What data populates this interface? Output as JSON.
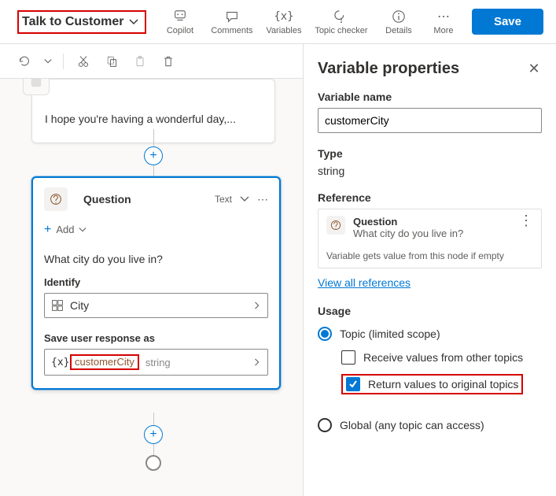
{
  "header": {
    "title": "Talk to Customer",
    "tools": {
      "copilot": "Copilot",
      "comments": "Comments",
      "variables": "Variables",
      "topicChecker": "Topic checker",
      "details": "Details",
      "more": "More"
    },
    "save": "Save"
  },
  "canvas": {
    "message": "I hope you're having a wonderful day,...",
    "question": {
      "title": "Question",
      "answerType": "Text",
      "addLabel": "Add",
      "text": "What city do you live in?",
      "identifyLabel": "Identify",
      "identifyValue": "City",
      "saveLabel": "Save user response as",
      "saveVarName": "customerCity",
      "saveVarType": "string"
    }
  },
  "panel": {
    "title": "Variable properties",
    "varNameLabel": "Variable name",
    "varName": "customerCity",
    "typeLabel": "Type",
    "typeValue": "string",
    "refLabel": "Reference",
    "refTitle": "Question",
    "refText": "What city do you live in?",
    "refNote": "Variable gets value from this node if empty",
    "viewAll": "View all references",
    "usageLabel": "Usage",
    "usage": {
      "topic": "Topic (limited scope)",
      "receive": "Receive values from other topics",
      "return": "Return values to original topics",
      "global": "Global (any topic can access)"
    }
  }
}
